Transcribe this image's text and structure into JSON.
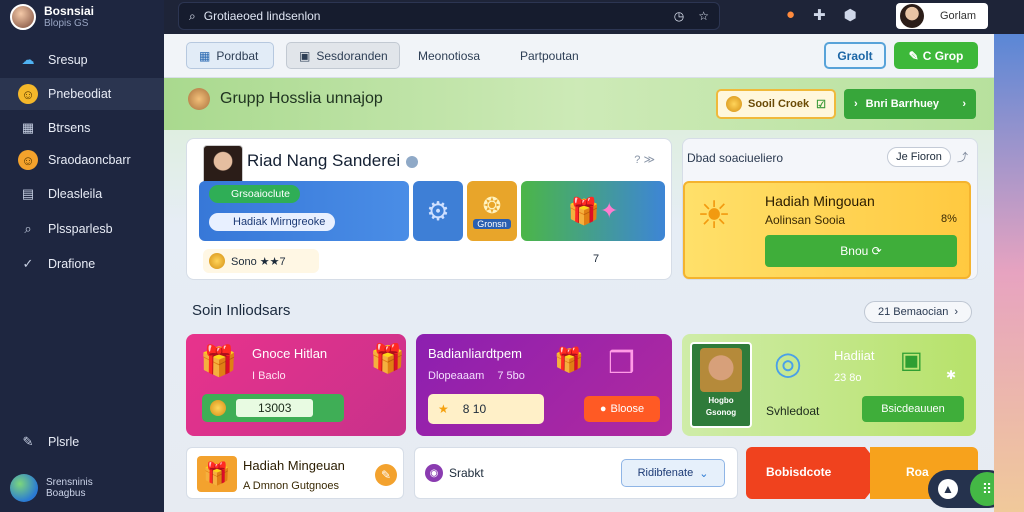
{
  "app": {
    "name": "Bosnsiai",
    "sub": "Blopis GS"
  },
  "sidebar": {
    "items": [
      {
        "label": "Sresup",
        "icon": "cloud-icon"
      },
      {
        "label": "Pnebeodiat",
        "icon": "smiley-icon"
      },
      {
        "label": "Btrsens",
        "icon": "grid-icon"
      },
      {
        "label": "Sraodaoncbarr",
        "icon": "smiley-icon"
      },
      {
        "label": "Dleasleila",
        "icon": "grid-icon"
      },
      {
        "label": "Plssparlesb",
        "icon": "search-icon"
      },
      {
        "label": "Drafione",
        "icon": "check-icon"
      }
    ],
    "bottom_item": {
      "label": "Plsrle",
      "icon": "edit-icon"
    },
    "footer": {
      "line1": "Srensninis",
      "line2": "Boagbus"
    }
  },
  "topbar": {
    "search_value": "Grotiaeoed lindsenlon",
    "user_label": "Gorlam"
  },
  "tabs": [
    {
      "label": "Pordbat"
    },
    {
      "label": "Sesdoranden"
    },
    {
      "label": "Meonotiosa"
    },
    {
      "label": "Partpoutan"
    }
  ],
  "header_buttons": {
    "outline": "Graolt",
    "green": "C Grop"
  },
  "group": {
    "title": "Grupp Hosslia unnajop",
    "pill_yellow": "Sooil Croek",
    "pill_green": "Bnri Barrhuey"
  },
  "profile_card": {
    "name": "Riad Nang Sanderei",
    "dots": "? ≫",
    "green_pill": "Grsoaioclute",
    "blue_pill": "Hadiak Mirngreoke",
    "tile_label": "Gronsn",
    "star_pill": "Sono ★★7",
    "gift_count": "7"
  },
  "weekly_card": {
    "header": "Dbad soaciueliero",
    "header_pill": "Je Fioron",
    "title": "Hadiah Mingouan",
    "subtitle": "Aolinsan Sooia",
    "percent": "8%",
    "button": "Bnou ⟳"
  },
  "section": {
    "title": "Soin Inliodsars",
    "pill": "21 Bemaocian"
  },
  "promos": [
    {
      "title": "Gnoce Hitlan",
      "sub": "I Baclo",
      "value": "13003"
    },
    {
      "title": "Badianliardtpem",
      "sub": "Dlopeaaam",
      "value": "8 10",
      "extra": "7 5bo",
      "button": "Bloose"
    },
    {
      "title": "Hadiiat",
      "sub": "23 8o",
      "badge_top": "Hogbo",
      "badge_bottom": "Gsonog",
      "caption": "Svhledoat",
      "button": "Bsicdeauuen"
    }
  ],
  "bottom": {
    "card1_title": "Hadiah Mingeuan",
    "card1_sub": "A Dmnon Gutgnoes",
    "card2_label": "Srabkt",
    "card2_button": "Ridibfenate",
    "card3_left": "Bobisdcote",
    "card3_right": "Roa"
  },
  "colors": {
    "accent_green": "#3db83a",
    "accent_blue": "#3778d8",
    "sidebar_bg": "#1e2640"
  }
}
